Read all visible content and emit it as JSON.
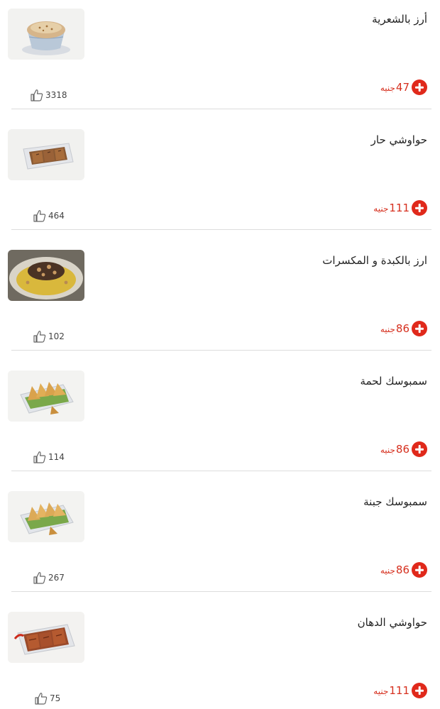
{
  "currency": "جنيه",
  "items": [
    {
      "name": "أرز بالشعرية",
      "price": "47",
      "likes": "3318",
      "image": "rice-vermicelli-bowl"
    },
    {
      "name": "حواوشي حار",
      "price": "111",
      "likes": "464",
      "image": "spicy-hawawshi-plate"
    },
    {
      "name": "ارز بالكبدة و المكسرات",
      "price": "86",
      "likes": "102",
      "image": "liver-rice-nuts-plate"
    },
    {
      "name": "سمبوسك لحمة",
      "price": "86",
      "likes": "114",
      "image": "meat-sambousek-plate"
    },
    {
      "name": "سمبوسك جبنة",
      "price": "86",
      "likes": "267",
      "image": "cheese-sambousek-plate"
    },
    {
      "name": "حواوشي الدهان",
      "price": "111",
      "likes": "75",
      "image": "dahhan-hawawshi-plate"
    }
  ],
  "colors": {
    "accent": "#e0291b",
    "price": "#d6301f",
    "divider": "#dddddd"
  }
}
